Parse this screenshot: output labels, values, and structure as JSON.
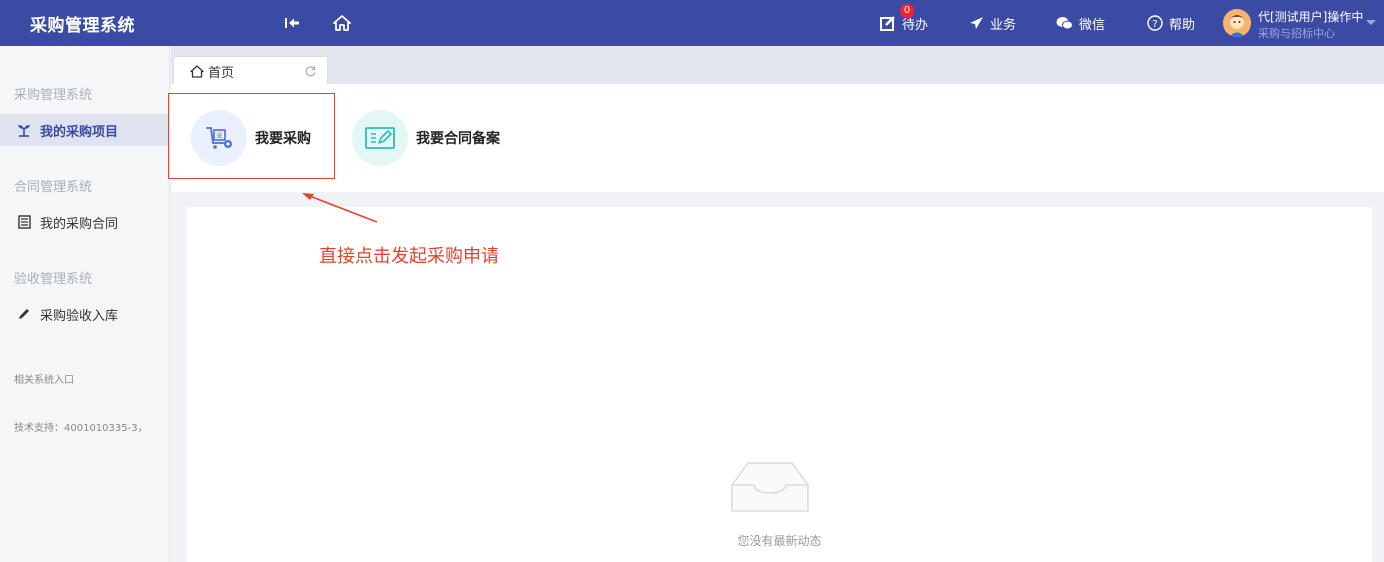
{
  "header": {
    "brand": "采购管理系统",
    "todo_label": "待办",
    "todo_count": "0",
    "business_label": "业务",
    "wechat_label": "微信",
    "help_label": "帮助",
    "user_name": "代[测试用户]操作中",
    "user_org": "采购与招标中心"
  },
  "sidebar": {
    "sections": [
      {
        "title": "采购管理系统",
        "item": "我的采购项目",
        "icon": "seedling-icon",
        "active": true
      },
      {
        "title": "合同管理系统",
        "item": "我的采购合同",
        "icon": "document-icon",
        "active": false
      },
      {
        "title": "验收管理系统",
        "item": "采购验收入库",
        "icon": "pencil-icon",
        "active": false
      }
    ],
    "related_label": "相关系统入口",
    "support_text": "技术支持：4001010335-3，"
  },
  "tabs": [
    {
      "label": "首页",
      "icon": "home-icon"
    }
  ],
  "quick_actions": [
    {
      "label": "我要采购",
      "icon": "cart-icon",
      "color": "#4a6fd8"
    },
    {
      "label": "我要合同备案",
      "icon": "contract-edit-icon",
      "color": "#2fbcb4"
    }
  ],
  "annotation": {
    "text": "直接点击发起采购申请",
    "color": "#e8412c"
  },
  "feed": {
    "empty_text": "您没有最新动态"
  }
}
